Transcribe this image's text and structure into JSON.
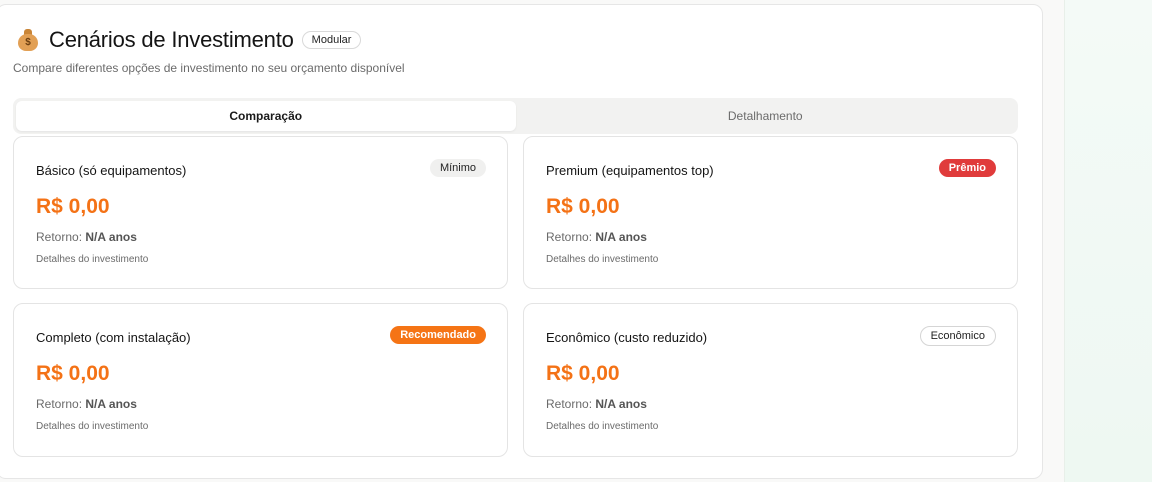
{
  "header": {
    "title": "Cenários de Investimento",
    "badge": "Modular",
    "icon_symbol": "$",
    "subtitle": "Compare diferentes opções de investimento no seu orçamento disponível"
  },
  "tabs": [
    {
      "label": "Comparação",
      "active": true
    },
    {
      "label": "Detalhamento",
      "active": false
    }
  ],
  "scenarios": [
    {
      "name": "Básico (só equipamentos)",
      "tag": "Mínimo",
      "price": "R$ 0,00",
      "return_label": "Retorno:",
      "return_value": "N/A anos",
      "details": "Detalhes do investimento"
    },
    {
      "name": "Premium (equipamentos top)",
      "tag": "Prêmio",
      "price": "R$ 0,00",
      "return_label": "Retorno:",
      "return_value": "N/A anos",
      "details": "Detalhes do investimento"
    },
    {
      "name": "Completo (com instalação)",
      "tag": "Recomendado",
      "price": "R$ 0,00",
      "return_label": "Retorno:",
      "return_value": "N/A anos",
      "details": "Detalhes do investimento"
    },
    {
      "name": "Econômico (custo reduzido)",
      "tag": "Econômico",
      "price": "R$ 0,00",
      "return_label": "Retorno:",
      "return_value": "N/A anos",
      "details": "Detalhes do investimento"
    }
  ],
  "colors": {
    "accent": "#f47216",
    "premium_tag": "#e03b3b",
    "recommended_tag": "#f57415"
  }
}
